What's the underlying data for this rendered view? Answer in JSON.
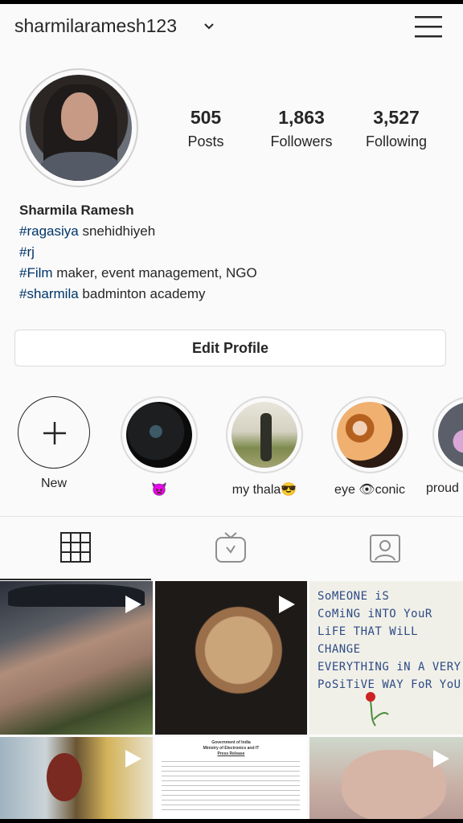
{
  "header": {
    "username": "sharmilaramesh123",
    "chevron_icon": "chevron-down-icon",
    "menu_icon": "hamburger-menu-icon"
  },
  "profile": {
    "stats": [
      {
        "value": "505",
        "label": "Posts"
      },
      {
        "value": "1,863",
        "label": "Followers"
      },
      {
        "value": "3,527",
        "label": "Following"
      }
    ],
    "name": "Sharmila Ramesh",
    "bio": [
      {
        "tag": "#ragasiya",
        "text": " snehidhiyeh"
      },
      {
        "tag": "#rj",
        "text": ""
      },
      {
        "tag": "#Film",
        "text": " maker, event management, NGO"
      },
      {
        "tag": "#sharmila",
        "text": " badminton academy"
      }
    ],
    "edit_button": "Edit Profile"
  },
  "highlights": [
    {
      "label": "New"
    },
    {
      "label": "👿"
    },
    {
      "label": "my thala😎"
    },
    {
      "label": "eye 👁conic"
    },
    {
      "label": "proud"
    }
  ],
  "tabs": {
    "grid_icon": "grid-icon",
    "igtv_icon": "igtv-icon",
    "tagged_icon": "tagged-person-icon"
  },
  "posts": {
    "quote_lines": [
      "SoMEONE iS",
      "CoMiNG iNTO YouR",
      "LiFE THAT WiLL CHANGE",
      "EVERYTHING iN A VERY",
      "PoSiTiVE WAY FoR YoU"
    ],
    "doc_lines": [
      "Government of India",
      "Ministry of Electronics and IT",
      "Press Release"
    ]
  },
  "colors": {
    "hashtag": "#003569",
    "text": "#262626",
    "border": "#dbdbdb"
  }
}
